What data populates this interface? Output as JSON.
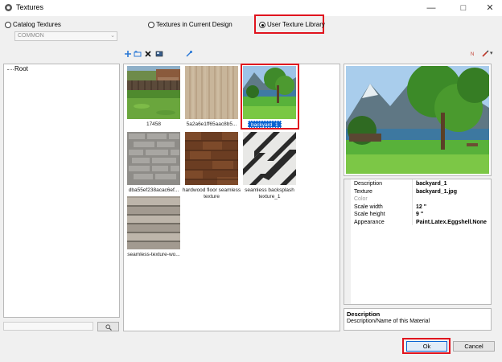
{
  "window": {
    "title": "Textures"
  },
  "source_options": [
    {
      "label": "Catalog Textures",
      "selected": false
    },
    {
      "label": "Textures in Current Design",
      "selected": false
    },
    {
      "label": "User Texture Library",
      "selected": true
    }
  ],
  "catalog_combo": {
    "value": "COMMON"
  },
  "tree": {
    "root_label": "Root"
  },
  "tiles": [
    {
      "caption": "17458",
      "selected": false
    },
    {
      "caption": "5a2a6e1ff65aac8b5...",
      "selected": false
    },
    {
      "caption": "backyard_1",
      "selected": true
    },
    {
      "caption": "dba55ef238acac6ef...",
      "selected": false
    },
    {
      "caption": "hardwood floor seamless texture",
      "selected": false
    },
    {
      "caption": "seamless backsplash texture_1",
      "selected": false
    },
    {
      "caption": "seamless-texture-wo...",
      "selected": false
    }
  ],
  "properties": [
    {
      "name": "Description",
      "value": "backyard_1"
    },
    {
      "name": "Texture",
      "value": "backyard_1.jpg"
    },
    {
      "name": "Color",
      "value": ""
    },
    {
      "name": "Scale width",
      "value": "12 \""
    },
    {
      "name": "Scale height",
      "value": "9 \""
    },
    {
      "name": "Appearance",
      "value": "Paint.Latex.Eggshell.None"
    }
  ],
  "description_panel": {
    "heading": "Description",
    "text": "Description/Name of this Material"
  },
  "buttons": {
    "ok": "Ok",
    "cancel": "Cancel"
  },
  "colors": {
    "selection_blue": "#0a64d2",
    "highlight_red": "#e0141e"
  }
}
